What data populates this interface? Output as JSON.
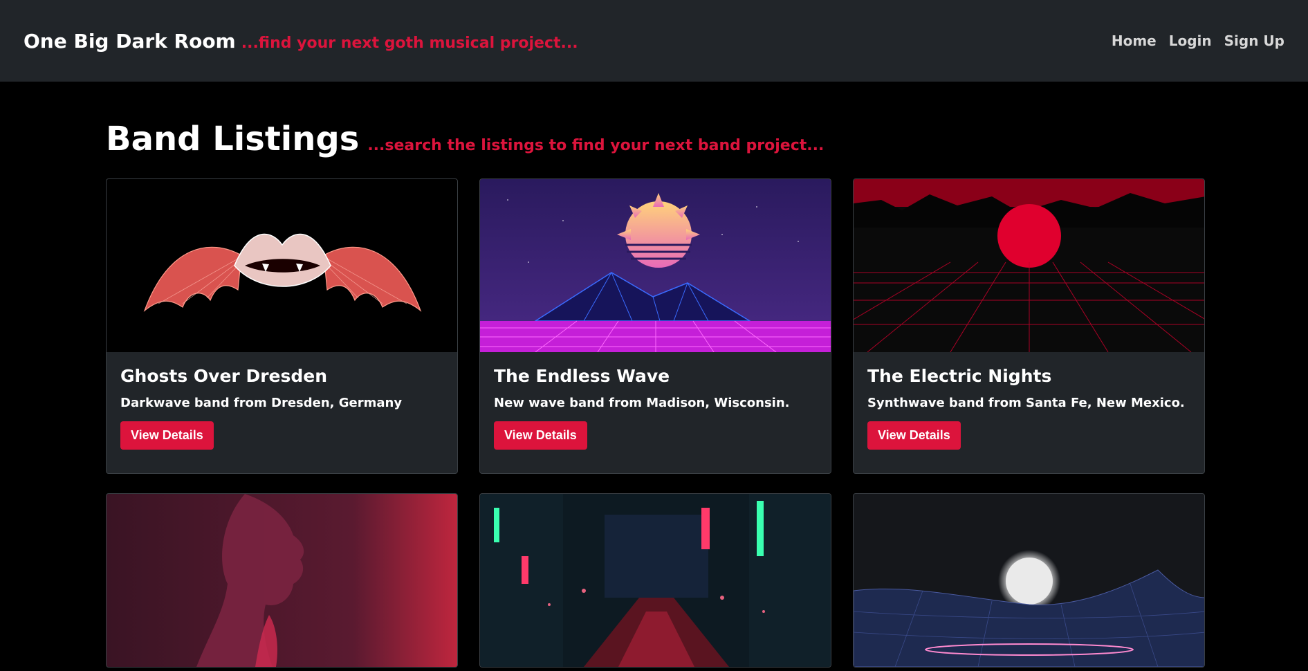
{
  "navbar": {
    "brand_title": "One Big Dark Room",
    "brand_tagline": "...find your next goth musical project...",
    "links": [
      "Home",
      "Login",
      "Sign Up"
    ]
  },
  "page": {
    "title": "Band Listings",
    "subtitle": "...search the listings to find your next band project..."
  },
  "cards": [
    {
      "title": "Ghosts Over Dresden",
      "description": "Darkwave band from Dresden, Germany",
      "button": "View Details"
    },
    {
      "title": "The Endless Wave",
      "description": "New wave band from Madison, Wisconsin.",
      "button": "View Details"
    },
    {
      "title": "The Electric Nights",
      "description": "Synthwave band from Santa Fe, New Mexico.",
      "button": "View Details"
    }
  ],
  "colors": {
    "accent": "#dc143c",
    "navbar": "#212529",
    "background": "#000000"
  }
}
